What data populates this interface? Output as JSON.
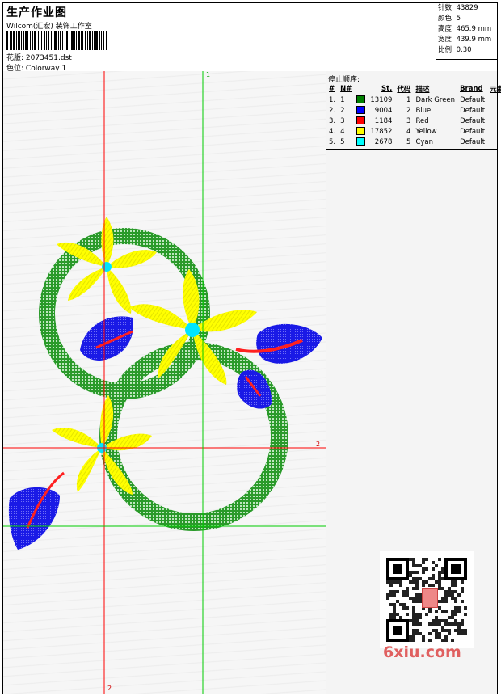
{
  "header": {
    "title": "生产作业图",
    "company": "Wilcom(汇宏) 装饰工作室",
    "file_label": "花版:",
    "file_value": "2073451.dst",
    "colorway_label": "色位:",
    "colorway_value": "Colorway 1"
  },
  "stats": [
    {
      "label": "针数:",
      "value": "43829"
    },
    {
      "label": "颜色:",
      "value": "5"
    },
    {
      "label": "高度:",
      "value": "465.9 mm"
    },
    {
      "label": "宽度:",
      "value": "439.9 mm"
    },
    {
      "label": "比例:",
      "value": "0.30"
    }
  ],
  "guides": {
    "top": "1",
    "right": "2",
    "bottom": "2"
  },
  "stop_sequence": {
    "title": "停止顺序:",
    "columns": [
      "#",
      "N#",
      "St.",
      "代码",
      "描述",
      "Brand",
      "元素"
    ],
    "rows": [
      {
        "seq": "1.",
        "n": "1",
        "color": "#008000",
        "stitches": "13109",
        "code": "1",
        "desc": "Dark Green",
        "brand": "Default"
      },
      {
        "seq": "2.",
        "n": "2",
        "color": "#0000ff",
        "stitches": "9004",
        "code": "2",
        "desc": "Blue",
        "brand": "Default"
      },
      {
        "seq": "3.",
        "n": "3",
        "color": "#ff0000",
        "stitches": "1184",
        "code": "3",
        "desc": "Red",
        "brand": "Default"
      },
      {
        "seq": "4.",
        "n": "4",
        "color": "#ffff00",
        "stitches": "17852",
        "code": "4",
        "desc": "Yellow",
        "brand": "Default"
      },
      {
        "seq": "5.",
        "n": "5",
        "color": "#00ffff",
        "stitches": "2678",
        "code": "5",
        "desc": "Cyan",
        "brand": "Default"
      }
    ]
  },
  "watermark": {
    "text": "6xiu.com"
  }
}
